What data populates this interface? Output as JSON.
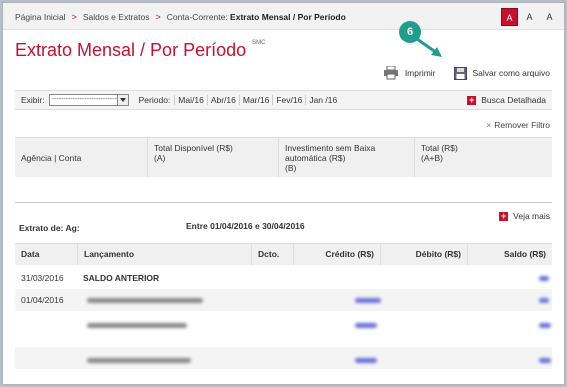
{
  "breadcrumb": {
    "items": [
      "Página Inicial",
      "Saldos e Extratos",
      "Conta-Corrente:"
    ],
    "current": "Extrato Mensal / Por Período"
  },
  "font_buttons": [
    "A",
    "A",
    "A"
  ],
  "page_title": "Extrato Mensal / Por Período",
  "page_title_tag": "SMC",
  "step_badge": "6",
  "actions": {
    "print": "Imprimir",
    "save": "Salvar como arquivo"
  },
  "filter": {
    "exibir_label": "Exibir:",
    "exibir_value": "--------------------------------",
    "periodo_label": "Periodo:",
    "months": [
      "Mai/16",
      "Abr/16",
      "Mar/16",
      "Fev/16",
      "Jan /16"
    ],
    "busca": "Busca Detalhada",
    "remover": "Remover Filtro"
  },
  "summary": {
    "col1": "Agência | Conta",
    "col2_line1": "Total Disponível (R$)",
    "col2_line2": "(A)",
    "col3_line1": "Investimento sem Baixa",
    "col3_line2": "automática (R$)",
    "col3_line3": "(B)",
    "col4_line1": "Total (R$)",
    "col4_line2": "(A+B)"
  },
  "statement": {
    "extrato_label": "Extrato de: Ag:",
    "period_text": "Entre 01/04/2016 e 30/04/2016",
    "veja_mais": "Veja mais"
  },
  "table": {
    "headers": [
      "Data",
      "Lançamento",
      "Dcto.",
      "Crédito (R$)",
      "Débito (R$)",
      "Saldo (R$)"
    ],
    "rows": [
      {
        "date": "31/03/2016",
        "desc": "SALDO ANTERIOR"
      },
      {
        "date": "01/04/2016",
        "desc": ""
      },
      {
        "date": "",
        "desc": ""
      },
      {
        "date": "",
        "desc": ""
      }
    ]
  },
  "colors": {
    "accent": "#c8102e",
    "badge": "#1e9e8e"
  }
}
